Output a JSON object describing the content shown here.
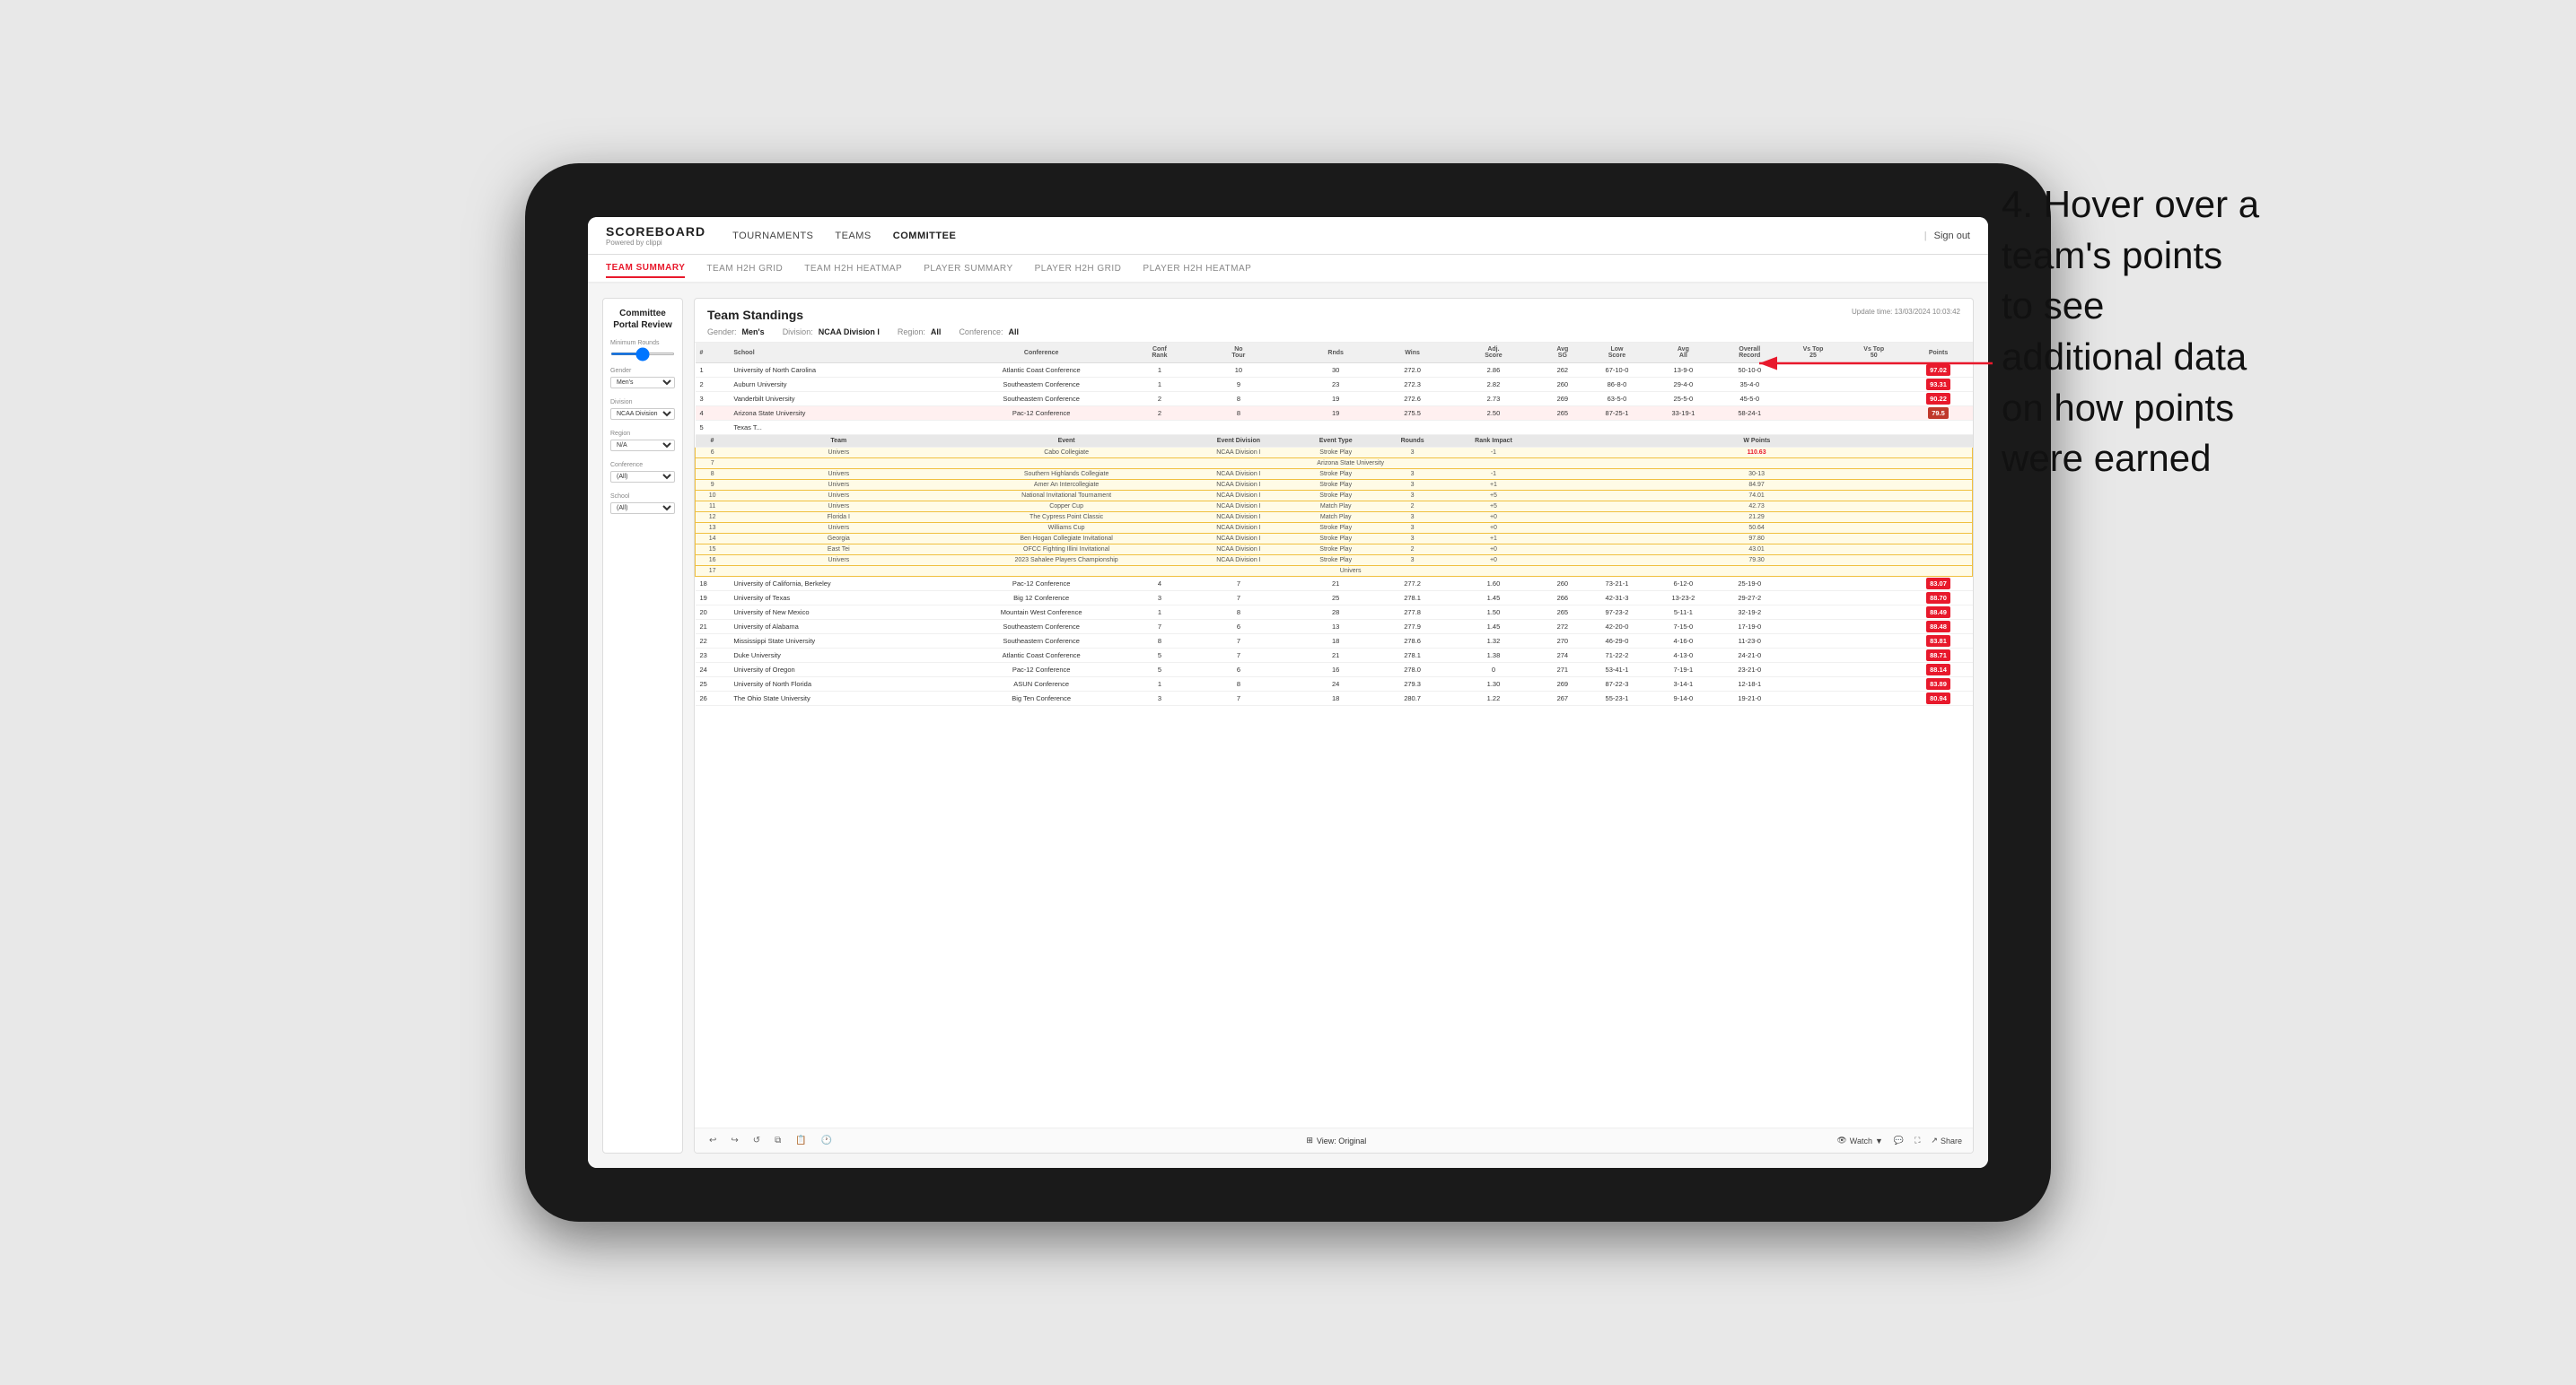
{
  "app": {
    "logo_title": "SCOREBOARD",
    "logo_sub": "Powered by clippi",
    "sign_out": "Sign out"
  },
  "nav": {
    "items": [
      "TOURNAMENTS",
      "TEAMS",
      "COMMITTEE"
    ]
  },
  "subnav": {
    "items": [
      "TEAM SUMMARY",
      "TEAM H2H GRID",
      "TEAM H2H HEATMAP",
      "PLAYER SUMMARY",
      "PLAYER H2H GRID",
      "PLAYER H2H HEATMAP"
    ],
    "active": "TEAM SUMMARY"
  },
  "sidebar": {
    "title": "Committee\nPortal Review",
    "minimum_rounds_label": "Minimum Rounds",
    "minimum_rounds_value": "5",
    "gender_label": "Gender",
    "gender_value": "Men's",
    "division_label": "Division",
    "division_value": "NCAA Division I",
    "region_label": "Region",
    "region_value": "N/A",
    "conference_label": "Conference",
    "conference_value": "(All)",
    "school_label": "School",
    "school_value": "(All)"
  },
  "main": {
    "title": "Team Standings",
    "update_time": "Update time: 13/03/2024 10:03:42",
    "filters": {
      "gender_label": "Gender:",
      "gender_value": "Men's",
      "division_label": "Division:",
      "division_value": "NCAA Division I",
      "region_label": "Region:",
      "region_value": "All",
      "conference_label": "Conference:",
      "conference_value": "All"
    },
    "table_headers": [
      "#",
      "School",
      "Conference",
      "Conf Rank",
      "No Tour",
      "Rnds",
      "Wins",
      "Adj Score",
      "Avg SG",
      "Low Score",
      "Avg All",
      "Overall Record",
      "Vs Top 25",
      "Vs Top 50",
      "Points"
    ],
    "rows": [
      {
        "rank": 1,
        "school": "University of North Carolina",
        "conference": "Atlantic Coast Conference",
        "conf_rank": 1,
        "no_tour": 10,
        "rnds": 30,
        "wins": 272.0,
        "adj_score": 2.86,
        "low_score": 262,
        "avg_all": "67-10-0",
        "overall_record": "13-9-0",
        "vs_top25": "50-10-0",
        "vs_top50": "",
        "points": "97.02",
        "highlight": false
      },
      {
        "rank": 2,
        "school": "Auburn University",
        "conference": "Southeastern Conference",
        "conf_rank": 1,
        "no_tour": 9,
        "rnds": 23,
        "wins": 272.3,
        "adj_score": 2.82,
        "low_score": 260,
        "avg_all": "86-8-0",
        "overall_record": "29-4-0",
        "vs_top25": "35-4-0",
        "vs_top50": "",
        "points": "93.31",
        "highlight": false
      },
      {
        "rank": 3,
        "school": "Vanderbilt University",
        "conference": "Southeastern Conference",
        "conf_rank": 2,
        "no_tour": 8,
        "rnds": 19,
        "wins": 272.6,
        "adj_score": 2.73,
        "low_score": 269,
        "avg_all": "63-5-0",
        "overall_record": "25-5-0",
        "vs_top25": "45-5-0",
        "vs_top50": "",
        "points": "90.22",
        "highlight": false
      },
      {
        "rank": 4,
        "school": "Arizona State University",
        "conference": "Pac-12 Conference",
        "conf_rank": 2,
        "no_tour": 8,
        "rnds": 19,
        "wins": 275.5,
        "adj_score": 2.5,
        "low_score": 265,
        "avg_all": "87-25-1",
        "overall_record": "33-19-1",
        "vs_top25": "58-24-1",
        "vs_top50": "",
        "points": "79.5",
        "highlight": true
      },
      {
        "rank": 5,
        "school": "Texas T...",
        "conference": "",
        "conf_rank": "",
        "no_tour": "",
        "rnds": "",
        "wins": "",
        "adj_score": "",
        "low_score": "",
        "avg_all": "",
        "overall_record": "",
        "vs_top25": "",
        "vs_top50": "",
        "points": "",
        "highlight": false
      }
    ],
    "popup_rows": [
      {
        "num": 6,
        "team": "Univers",
        "event": "Cabo Collegiate",
        "event_division": "NCAA Division I",
        "event_type": "Stroke Play",
        "rounds": 3,
        "rank_impact": "-1",
        "points": "110.63"
      },
      {
        "num": 7,
        "team": "Arizona State University",
        "event": "",
        "event_division": "",
        "event_type": "",
        "rounds": "",
        "rank_impact": "",
        "points": ""
      },
      {
        "num": 8,
        "team": "Univers",
        "event": "Southern Highlands Collegiate",
        "event_division": "NCAA Division I",
        "event_type": "Stroke Play",
        "rounds": 3,
        "rank_impact": "-1",
        "points": "30-13"
      },
      {
        "num": 9,
        "team": "Univers",
        "event": "Amer An Intercollegiate",
        "event_division": "NCAA Division I",
        "event_type": "Stroke Play",
        "rounds": 3,
        "rank_impact": "+1",
        "points": "84.97"
      },
      {
        "num": 10,
        "team": "Univers",
        "event": "National Invitational Tournament",
        "event_division": "NCAA Division I",
        "event_type": "Stroke Play",
        "rounds": 3,
        "rank_impact": "+5",
        "points": "74.01"
      },
      {
        "num": 11,
        "team": "Univers",
        "event": "Copper Cup",
        "event_division": "NCAA Division I",
        "event_type": "Match Play",
        "rounds": 2,
        "rank_impact": "+5",
        "points": "42.73"
      },
      {
        "num": 12,
        "team": "Florida I",
        "event": "The Cypress Point Classic",
        "event_division": "NCAA Division I",
        "event_type": "Match Play",
        "rounds": 3,
        "rank_impact": "+0",
        "points": "21.29"
      },
      {
        "num": 13,
        "team": "Univers",
        "event": "Williams Cup",
        "event_division": "NCAA Division I",
        "event_type": "Stroke Play",
        "rounds": 3,
        "rank_impact": "+0",
        "points": "50.64"
      },
      {
        "num": 14,
        "team": "Georgia",
        "event": "Ben Hogan Collegiate Invitational",
        "event_division": "NCAA Division I",
        "event_type": "Stroke Play",
        "rounds": 3,
        "rank_impact": "+1",
        "points": "97.80"
      },
      {
        "num": 15,
        "team": "East Tei",
        "event": "OFCC Fighting Illini Invitational",
        "event_division": "NCAA Division I",
        "event_type": "Stroke Play",
        "rounds": 2,
        "rank_impact": "+0",
        "points": "43.01"
      },
      {
        "num": 16,
        "team": "Univers",
        "event": "2023 Sahalee Players Championship",
        "event_division": "NCAA Division I",
        "event_type": "Stroke Play",
        "rounds": 3,
        "rank_impact": "+0",
        "points": "79.30"
      },
      {
        "num": 17,
        "team": "Univers",
        "event": "",
        "event_division": "",
        "event_type": "",
        "rounds": "",
        "rank_impact": "",
        "points": ""
      }
    ],
    "lower_rows": [
      {
        "rank": 18,
        "school": "University of California, Berkeley",
        "conference": "Pac-12 Conference",
        "conf_rank": 4,
        "no_tour": 7,
        "rnds": 21,
        "wins": 277.2,
        "adj_score": 1.6,
        "low_score": 260,
        "avg_all": "73-21-1",
        "overall_record": "6-12-0",
        "vs_top25": "25-19-0",
        "vs_top50": "",
        "points": "83.07"
      },
      {
        "rank": 19,
        "school": "University of Texas",
        "conference": "Big 12 Conference",
        "conf_rank": 3,
        "no_tour": 7,
        "rnds": 25,
        "wins": 278.1,
        "adj_score": 1.45,
        "low_score": 266,
        "avg_all": "42-31-3",
        "overall_record": "13-23-2",
        "vs_top25": "29-27-2",
        "vs_top50": "",
        "points": "88.70"
      },
      {
        "rank": 20,
        "school": "University of New Mexico",
        "conference": "Mountain West Conference",
        "conf_rank": 1,
        "no_tour": 8,
        "rnds": 28,
        "wins": 277.8,
        "adj_score": 1.5,
        "low_score": 265,
        "avg_all": "97-23-2",
        "overall_record": "5-11-1",
        "vs_top25": "32-19-2",
        "vs_top50": "",
        "points": "88.49"
      },
      {
        "rank": 21,
        "school": "University of Alabama",
        "conference": "Southeastern Conference",
        "conf_rank": 7,
        "no_tour": 6,
        "rnds": 13,
        "wins": 277.9,
        "adj_score": 1.45,
        "low_score": 272,
        "avg_all": "42-20-0",
        "overall_record": "7-15-0",
        "vs_top25": "17-19-0",
        "vs_top50": "",
        "points": "88.48"
      },
      {
        "rank": 22,
        "school": "Mississippi State University",
        "conference": "Southeastern Conference",
        "conf_rank": 8,
        "no_tour": 7,
        "rnds": 18,
        "wins": 278.6,
        "adj_score": 1.32,
        "low_score": 270,
        "avg_all": "46-29-0",
        "overall_record": "4-16-0",
        "vs_top25": "11-23-0",
        "vs_top50": "",
        "points": "83.81"
      },
      {
        "rank": 23,
        "school": "Duke University",
        "conference": "Atlantic Coast Conference",
        "conf_rank": 5,
        "no_tour": 7,
        "rnds": 21,
        "wins": 278.1,
        "adj_score": 1.38,
        "low_score": 274,
        "avg_all": "71-22-2",
        "overall_record": "4-13-0",
        "vs_top25": "24-21-0",
        "vs_top50": "",
        "points": "88.71"
      },
      {
        "rank": 24,
        "school": "University of Oregon",
        "conference": "Pac-12 Conference",
        "conf_rank": 5,
        "no_tour": 6,
        "rnds": 16,
        "wins": 278.0,
        "adj_score": 0,
        "low_score": 271,
        "avg_all": "53-41-1",
        "overall_record": "7-19-1",
        "vs_top25": "23-21-0",
        "vs_top50": "",
        "points": "88.14"
      },
      {
        "rank": 25,
        "school": "University of North Florida",
        "conference": "ASUN Conference",
        "conf_rank": 1,
        "no_tour": 8,
        "rnds": 24,
        "wins": 279.3,
        "adj_score": 1.3,
        "low_score": 269,
        "avg_all": "87-22-3",
        "overall_record": "3-14-1",
        "vs_top25": "12-18-1",
        "vs_top50": "",
        "points": "83.89"
      },
      {
        "rank": 26,
        "school": "The Ohio State University",
        "conference": "Big Ten Conference",
        "conf_rank": 3,
        "no_tour": 7,
        "rnds": 18,
        "wins": 280.7,
        "adj_score": 1.22,
        "low_score": 267,
        "avg_all": "55-23-1",
        "overall_record": "9-14-0",
        "vs_top25": "19-21-0",
        "vs_top50": "",
        "points": "80.94"
      }
    ],
    "popup_col_headers": [
      "#",
      "Team",
      "Event",
      "Event Division",
      "Event Type",
      "Rounds",
      "Rank Impact",
      "W Points"
    ]
  },
  "toolbar": {
    "view_label": "View: Original",
    "watch_label": "Watch",
    "share_label": "Share"
  },
  "annotation": {
    "text": "4. Hover over a\nteam's points\nto see\nadditional data\non how points\nwere earned"
  }
}
